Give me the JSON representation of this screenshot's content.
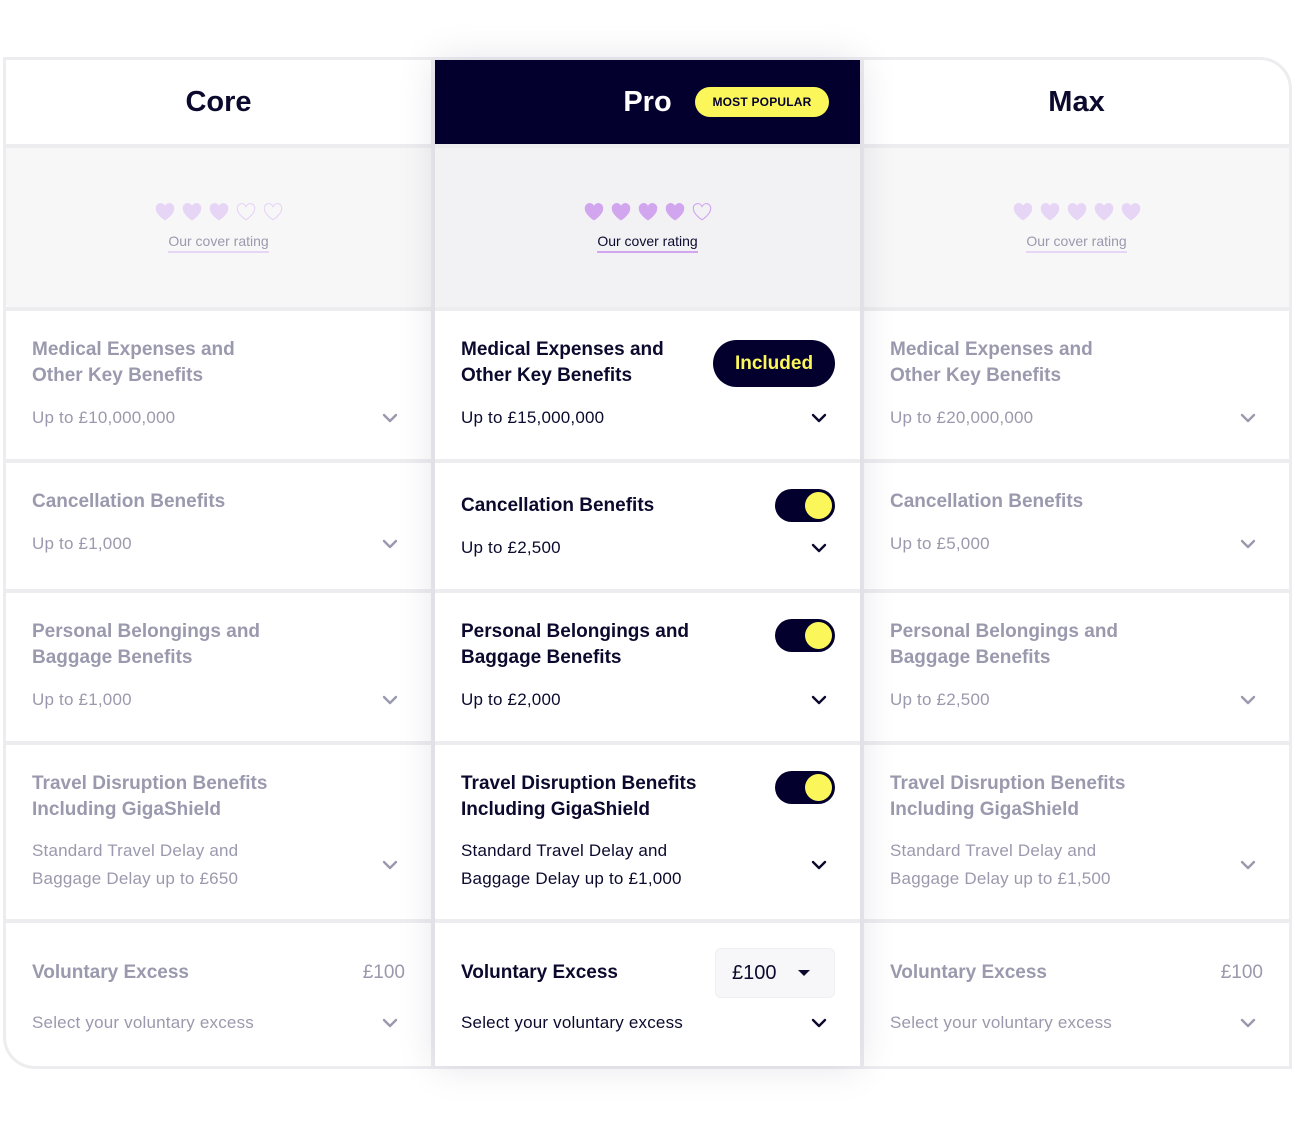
{
  "plans": [
    {
      "name": "Core",
      "rating": {
        "filled": 3,
        "total": 5,
        "label": "Our cover rating"
      },
      "benefits": [
        {
          "title": "Medical Expenses and\nOther Key Benefits",
          "value": "Up to £10,000,000"
        },
        {
          "title": "Cancellation Benefits",
          "value": "Up to £1,000"
        },
        {
          "title": "Personal Belongings and\nBaggage Benefits",
          "value": "Up to £1,000"
        },
        {
          "title": "Travel Disruption Benefits\nIncluding GigaShield",
          "value": "Standard Travel Delay and\nBaggage Delay up to £650"
        }
      ],
      "excess": {
        "title": "Voluntary Excess",
        "amount": "£100",
        "hint": "Select your voluntary excess"
      }
    },
    {
      "name": "Pro",
      "badge": "MOST POPULAR",
      "highlighted": true,
      "rating": {
        "filled": 4,
        "total": 5,
        "label": "Our cover rating"
      },
      "benefits": [
        {
          "title": "Medical Expenses and\nOther Key Benefits",
          "value": "Up to £15,000,000",
          "control": {
            "type": "pill",
            "label": "Included"
          }
        },
        {
          "title": "Cancellation Benefits",
          "value": "Up to £2,500",
          "control": {
            "type": "toggle",
            "on": true
          }
        },
        {
          "title": "Personal Belongings and\nBaggage Benefits",
          "value": "Up to £2,000",
          "control": {
            "type": "toggle",
            "on": true
          }
        },
        {
          "title": "Travel Disruption Benefits\nIncluding GigaShield",
          "value": "Standard Travel Delay and\nBaggage Delay up to £1,000",
          "control": {
            "type": "toggle",
            "on": true
          }
        }
      ],
      "excess": {
        "title": "Voluntary Excess",
        "amount": "£100",
        "hint": "Select your voluntary excess",
        "control": "dropdown"
      }
    },
    {
      "name": "Max",
      "rating": {
        "filled": 5,
        "total": 5,
        "label": "Our cover rating"
      },
      "benefits": [
        {
          "title": "Medical Expenses and\nOther Key Benefits",
          "value": "Up to £20,000,000"
        },
        {
          "title": "Cancellation Benefits",
          "value": "Up to £5,000"
        },
        {
          "title": "Personal Belongings and\nBaggage Benefits",
          "value": "Up to £2,500"
        },
        {
          "title": "Travel Disruption Benefits\nIncluding GigaShield",
          "value": "Standard Travel Delay and\nBaggage Delay up to £1,500"
        }
      ],
      "excess": {
        "title": "Voluntary Excess",
        "amount": "£100",
        "hint": "Select your voluntary excess"
      }
    }
  ],
  "icons": {
    "rating": "heart-icon",
    "expand": "chevron-down-icon",
    "dropdown": "caret-down-icon"
  },
  "colors": {
    "navy": "#03002e",
    "accent_yellow": "#fbf75b",
    "muted_text": "#9b99ad",
    "heart_highlight": "#d2a6ef",
    "heart_muted": "#e7d5f6"
  }
}
